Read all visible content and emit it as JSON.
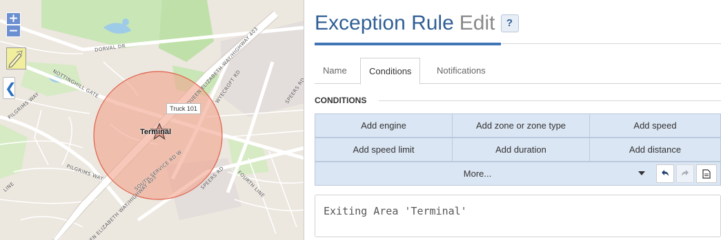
{
  "map": {
    "zoom_in": "+",
    "zoom_out": "−",
    "truck_label": "Truck 101",
    "zone_label": "Terminal",
    "road_labels": [
      "DORVAL DR",
      "NOTTINGHILL GATE",
      "PILGRIMS WAY",
      "PILGRIMS WAY",
      "QUEEN ELIZABETH WAY/HIGHWAY 403",
      "WYECROFT RD",
      "SPEERS RD",
      "SOUTH SERVICE RD W",
      "SPEERS RD",
      "FOURTH LINE",
      "QUEEN ELIZABETH WAY/HIGHWAY 403",
      "LINE"
    ],
    "zone_fill_color": "#f2a48c",
    "zone_stroke_color": "#e0604a",
    "park_color": "#c9e6b6",
    "water_color": "#9ecbe8",
    "highway_color": "#ffffff"
  },
  "editor": {
    "title_main": "Exception Rule",
    "title_edit": "Edit",
    "help_label": "?",
    "tabs": [
      {
        "label": "Name",
        "active": false
      },
      {
        "label": "Conditions",
        "active": true
      },
      {
        "label": "Notifications",
        "active": false
      }
    ],
    "section_title": "CONDITIONS",
    "buttons_row1": [
      "Add engine",
      "Add zone or zone type",
      "Add speed"
    ],
    "buttons_row2": [
      "Add speed limit",
      "Add duration",
      "Add distance"
    ],
    "more_label": "More...",
    "undo_icon": "undo-icon",
    "redo_icon": "redo-icon",
    "doc_icon": "document-icon",
    "expression": "Exiting Area 'Terminal'"
  }
}
